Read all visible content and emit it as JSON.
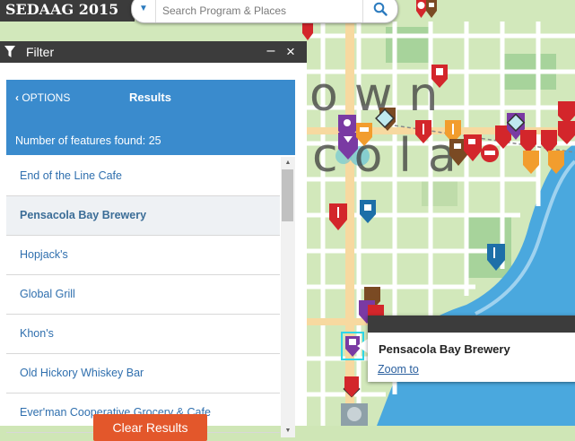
{
  "app": {
    "title": "SEDAAG 2015"
  },
  "search": {
    "placeholder": "Search Program & Places",
    "dropdown_icon": "caret-down-icon",
    "button_icon": "magnifier-icon"
  },
  "filter_panel": {
    "title": "Filter",
    "icon": "funnel-icon",
    "minimize_label": "–",
    "close_label": "×",
    "options_label": "OPTIONS",
    "results_title": "Results",
    "features_found": "Number of features found: 25",
    "items": [
      {
        "label": "End of the Line Cafe",
        "selected": false
      },
      {
        "label": "Pensacola Bay Brewery",
        "selected": true
      },
      {
        "label": "Hopjack's",
        "selected": false
      },
      {
        "label": "Global Grill",
        "selected": false
      },
      {
        "label": "Khon's",
        "selected": false
      },
      {
        "label": "Old Hickory Whiskey Bar",
        "selected": false
      },
      {
        "label": "Ever'man Cooperative Grocery & Cafe",
        "selected": false
      }
    ],
    "clear_label": "Clear Results"
  },
  "popup": {
    "title": "Pensacola Bay Brewery",
    "zoom_label": "Zoom to"
  },
  "map": {
    "labels": [
      "own",
      "cola"
    ],
    "colors": {
      "water": "#4aa8de",
      "land": "#d2e8bb",
      "park": "#a7d39b",
      "road": "#ffffff",
      "accent": "#3a8bcd",
      "clear_button": "#e3572b"
    }
  }
}
